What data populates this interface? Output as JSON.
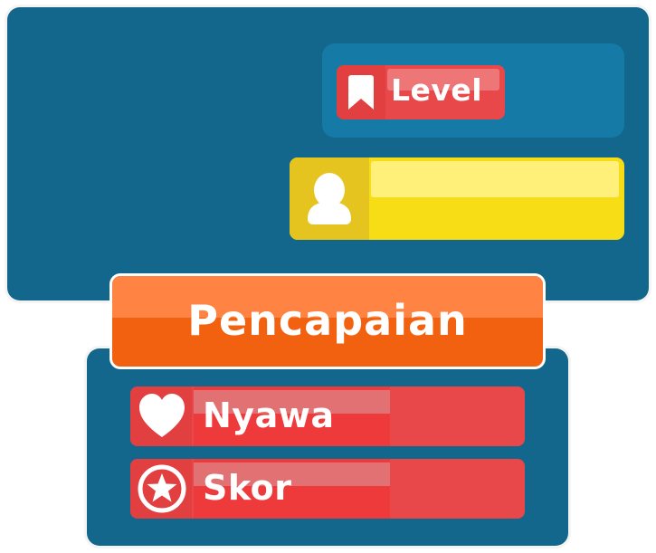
{
  "colors": {
    "panel": "#13678c",
    "panel_inner": "#157aa6",
    "red": "#e8484a",
    "red_fill": "#ef3a3c",
    "yellow": "#f7dd16",
    "orange": "#f2610f"
  },
  "top": {
    "level": {
      "icon": "bookmark-icon",
      "label": "Level"
    },
    "player": {
      "icon": "user-avatar-icon",
      "name": ""
    }
  },
  "achievements": {
    "title": "Pencapaian",
    "stats": [
      {
        "icon": "heart-icon",
        "label": "Nyawa",
        "fill_fraction": 0.6
      },
      {
        "icon": "star-circle-icon",
        "label": "Skor",
        "fill_fraction": 0.6
      }
    ]
  }
}
